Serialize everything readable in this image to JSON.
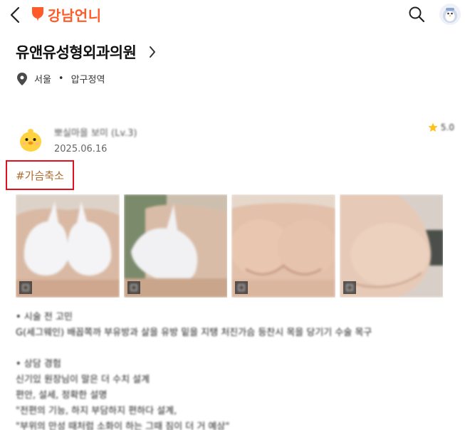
{
  "app": {
    "logo_text": "강남언니",
    "brand_color": "#ff5a28"
  },
  "header": {
    "back_icon": "chevron-left-icon",
    "search_icon": "search-icon",
    "profile_icon": "penguin-avatar-icon"
  },
  "hospital": {
    "name": "유앤유성형외과의원",
    "location_city": "서울",
    "location_separator": "•",
    "location_area": "압구정역"
  },
  "review": {
    "nickname": "뽀실마을 보미 (Lv.3)",
    "date": "2025.06.16",
    "rating": "5.0",
    "hashtag": "#가슴축소",
    "photos_count": 4,
    "body": {
      "line1": "• 시술 전 고민",
      "line2": "G(세그웨인) 배꼽쪽까 부유방과 살을 유방 밑을 지탱 처진가슴 등찬시 목을 당기기 수술 목구",
      "line3": "• 상담 경험",
      "line4": "신기있 원장님이 말은 더 수치 설계",
      "line5": "편안, 설세, 정확한 설명",
      "line6": "\"전편의 기능, 하지 부담하지 편하다 설계,",
      "line7": "\"부위의 만성 때처럼 소화이 하는 그때 짐이 더 거 예상\""
    }
  }
}
